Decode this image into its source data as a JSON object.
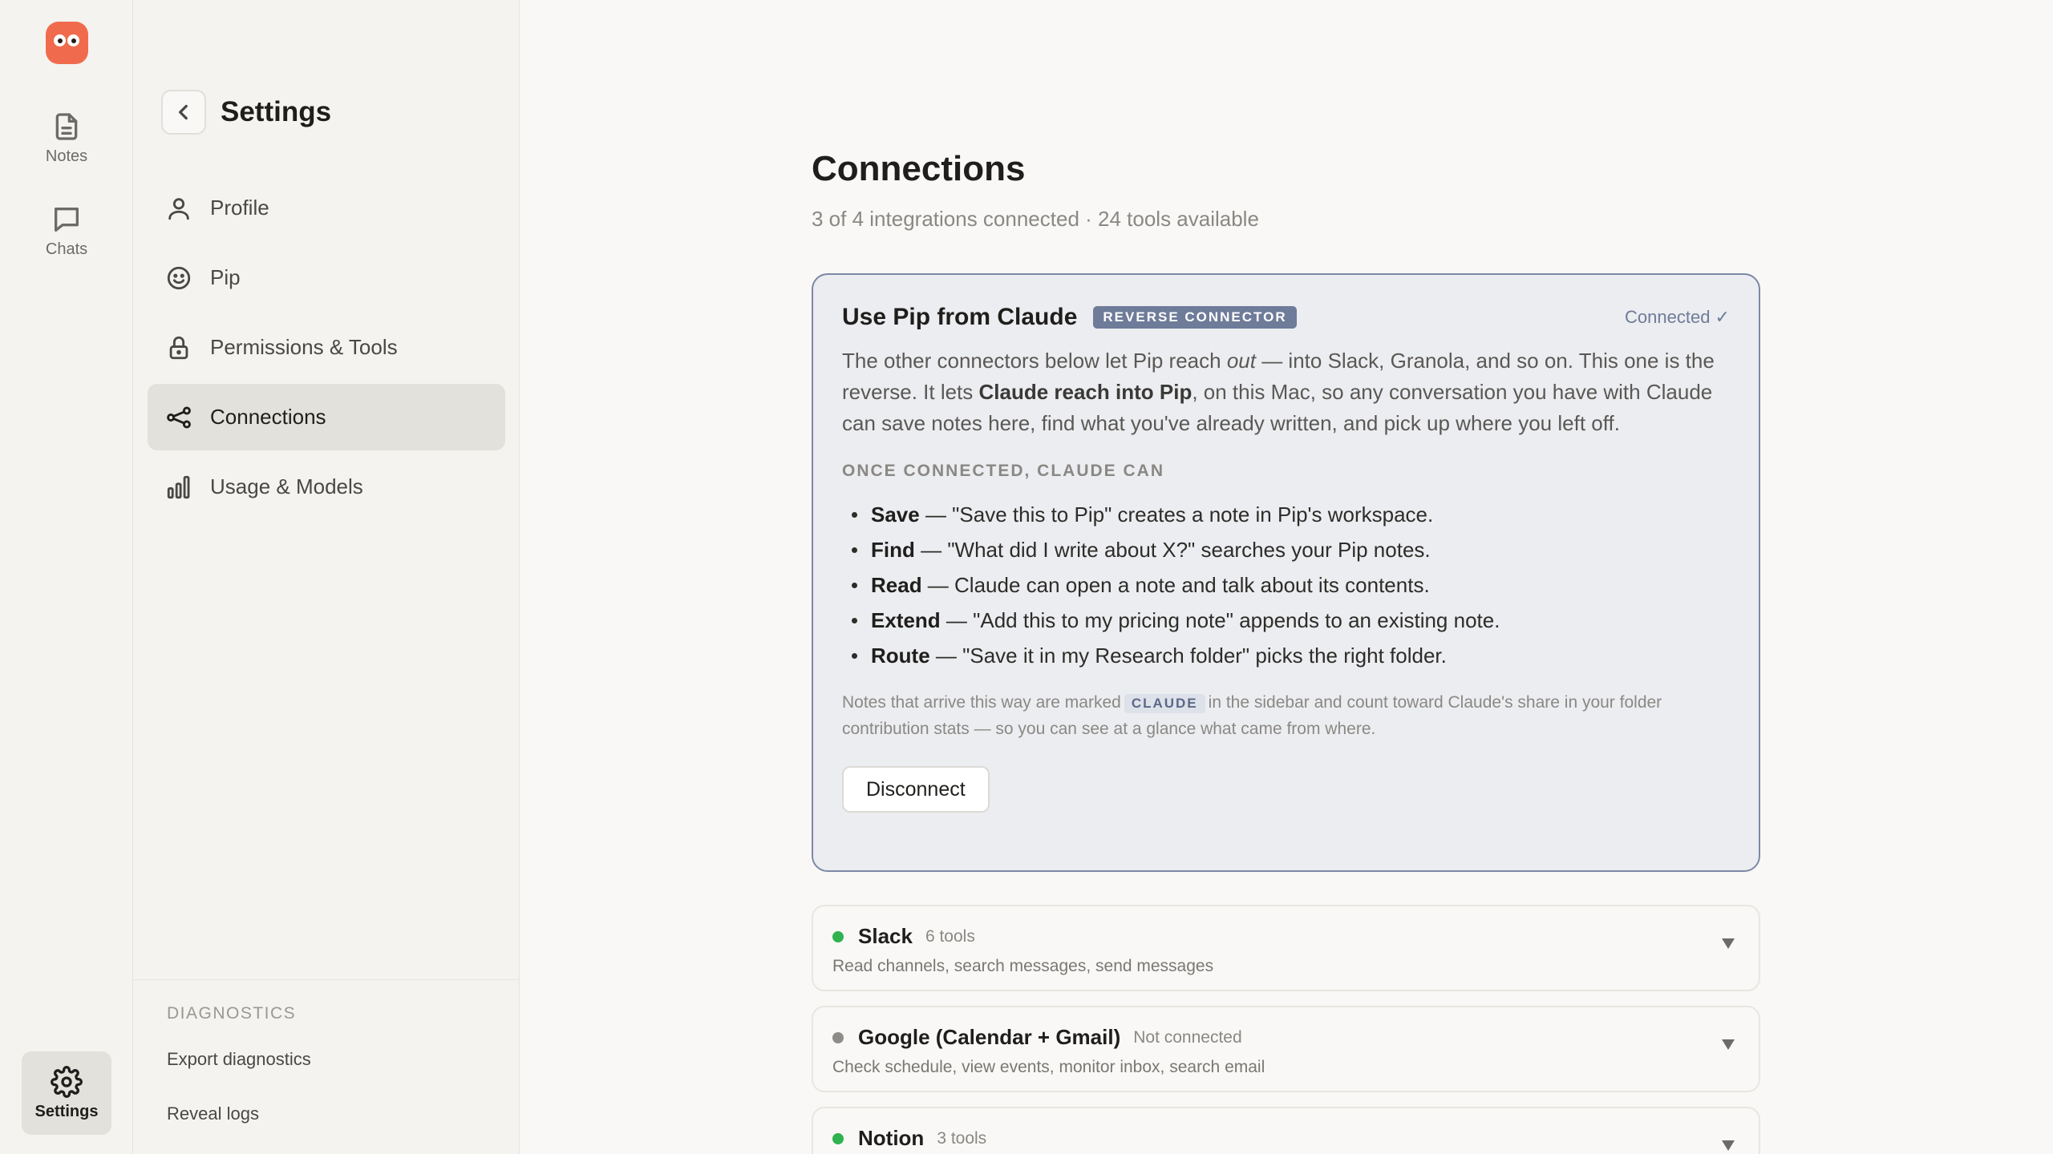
{
  "rail": {
    "notes_label": "Notes",
    "chats_label": "Chats",
    "settings_label": "Settings"
  },
  "sidebar": {
    "title": "Settings",
    "items": [
      {
        "label": "Profile",
        "icon": "person-icon"
      },
      {
        "label": "Pip",
        "icon": "smiley-icon"
      },
      {
        "label": "Permissions & Tools",
        "icon": "lock-icon"
      },
      {
        "label": "Connections",
        "icon": "share-nodes-icon",
        "active": true
      },
      {
        "label": "Usage & Models",
        "icon": "bar-chart-icon"
      }
    ],
    "diagnostics": {
      "title": "DIAGNOSTICS",
      "export": "Export diagnostics",
      "logs": "Reveal logs"
    }
  },
  "main": {
    "title": "Connections",
    "subtitle": "3 of 4 integrations connected · 24 tools available",
    "hero": {
      "title": "Use Pip from Claude",
      "badge": "REVERSE CONNECTOR",
      "status": "Connected ✓",
      "desc_1": "The other connectors below let Pip reach ",
      "desc_out": "out",
      "desc_2": " — into Slack, Granola, and so on. This one is the reverse. It lets ",
      "desc_bold": "Claude reach into Pip",
      "desc_3": ", on this Mac, so any conversation you have with Claude can save notes here, find what you've already written, and pick up where you left off.",
      "section_title": "ONCE CONNECTED, CLAUDE CAN",
      "capabilities": [
        {
          "name": "Save",
          "text": " — \"Save this to Pip\" creates a note in Pip's workspace."
        },
        {
          "name": "Find",
          "text": " — \"What did I write about X?\" searches your Pip notes."
        },
        {
          "name": "Read",
          "text": " — Claude can open a note and talk about its contents."
        },
        {
          "name": "Extend",
          "text": " — \"Add this to my pricing note\" appends to an existing note."
        },
        {
          "name": "Route",
          "text": " — \"Save it in my Research folder\" picks the right folder."
        }
      ],
      "note_1": "Notes that arrive this way are marked",
      "note_tag": "CLAUDE",
      "note_2": "in the sidebar and count toward Claude's share in your folder contribution stats — so you can see at a glance what came from where.",
      "disconnect_label": "Disconnect",
      "accent_color": "#6e7b99"
    },
    "connectors": [
      {
        "name": "Slack",
        "meta": "6 tools",
        "desc": "Read channels, search messages, send messages",
        "status_color": "#2fb24f"
      },
      {
        "name": "Google (Calendar + Gmail)",
        "meta": "Not connected",
        "desc": "Check schedule, view events, monitor inbox, search email",
        "status_color": "#8e8c88"
      },
      {
        "name": "Notion",
        "meta": "3 tools",
        "desc": "",
        "status_color": "#2fb24f"
      }
    ]
  }
}
